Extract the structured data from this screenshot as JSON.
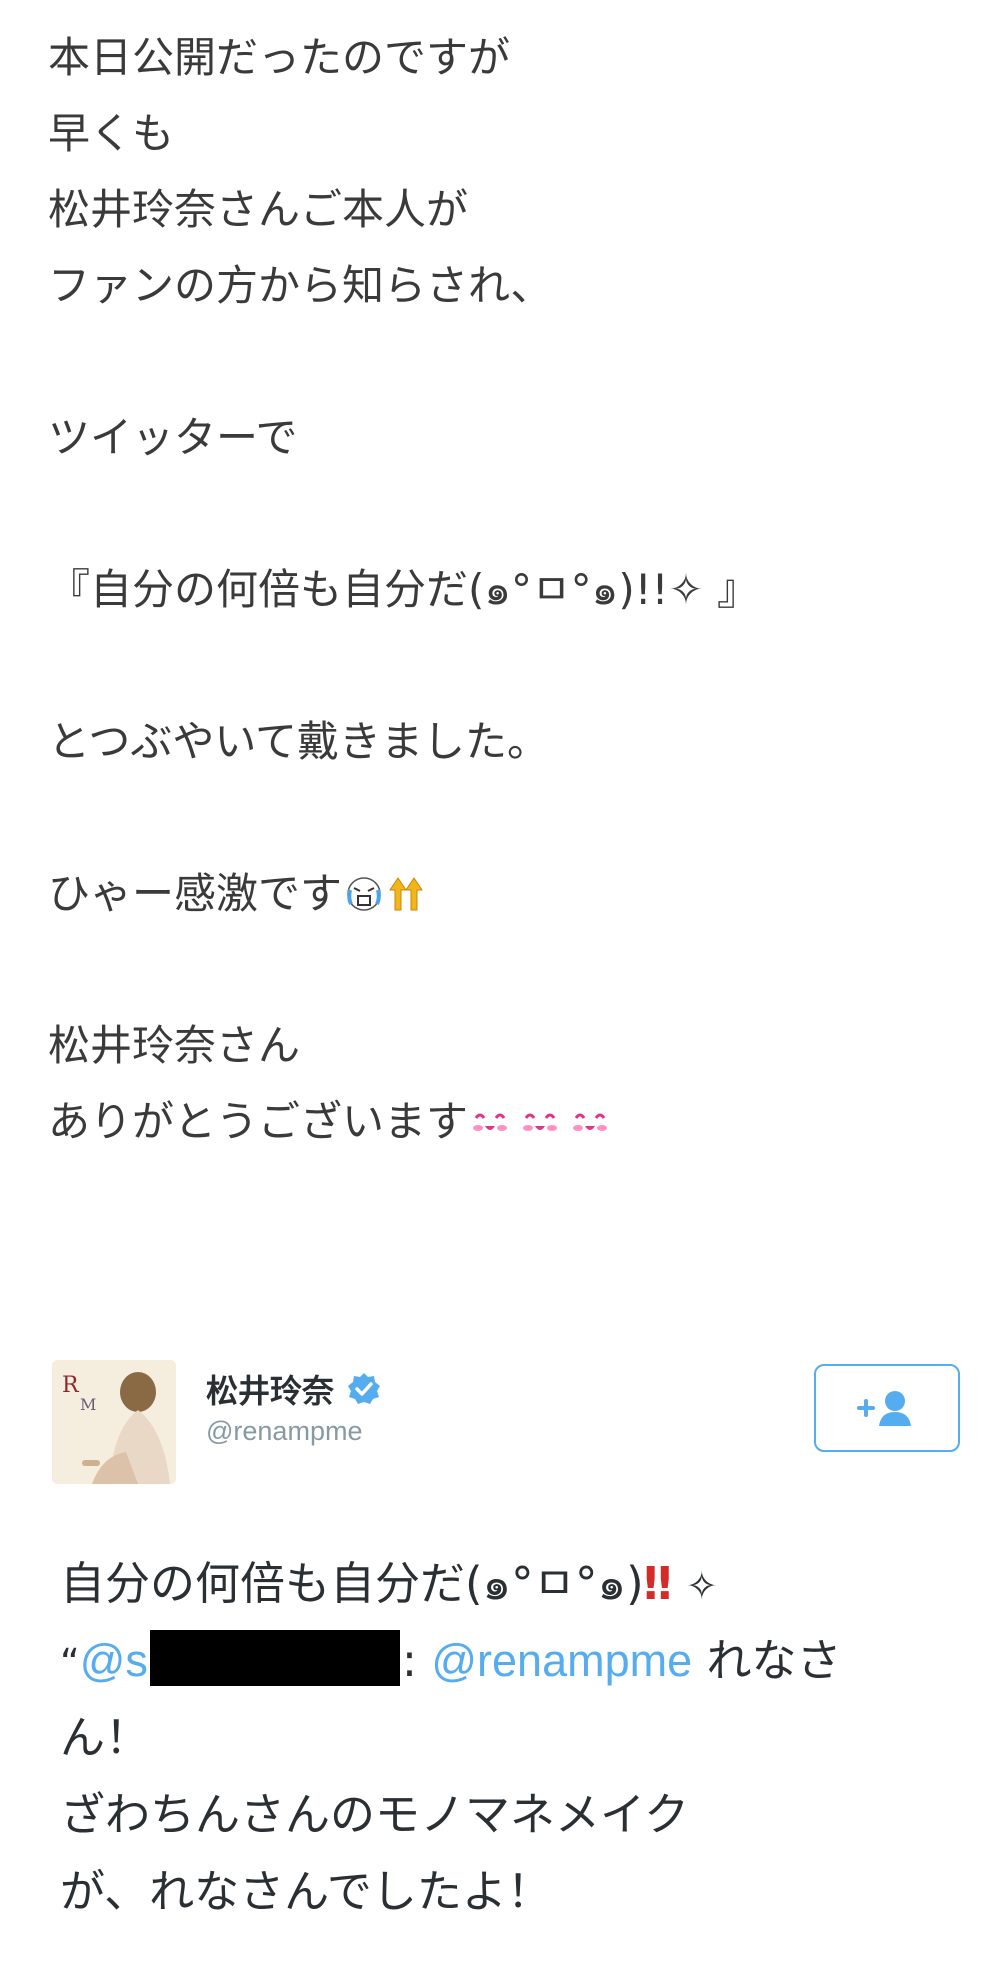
{
  "blog": {
    "line1": "本日公開だったのですが",
    "line2": "早くも",
    "line3": "松井玲奈さんご本人が",
    "line4": "ファンの方から知らされ、",
    "line5": "ツイッターで",
    "line6": "『自分の何倍も自分だ(๑°ㅁ°๑)!!✧ 』",
    "line7": "とつぶやいて戴きました。",
    "line8": "ひゃー感激です",
    "line9": "松井玲奈さん",
    "line10": "ありがとうございます",
    "emoji_cry": "crying-face-icon",
    "emoji_up": "double-up-arrow-icon",
    "emoji_happy": "blushing-face-icon"
  },
  "tweet": {
    "avatar_letters": "R M",
    "name": "松井玲奈",
    "handle": "@renampme",
    "follow_icon": "follow-plus-user-icon",
    "text_line1_a": "自分の何倍も自分だ(๑°ㅁ°๑)",
    "text_line1_b": "‼",
    "text_line1_c": "✧",
    "quote_open": "“",
    "mention_partial": "@s",
    "colon": ":",
    "mention_main": "@renampme",
    "text_line2_tail": " れなさ",
    "text_line3": "ん！",
    "text_line4": "ざわちんさんのモノマネメイク",
    "text_line5": "が、れなさんでしたよ！",
    "accent_color": "#55acee",
    "verified_color": "#55acee"
  }
}
